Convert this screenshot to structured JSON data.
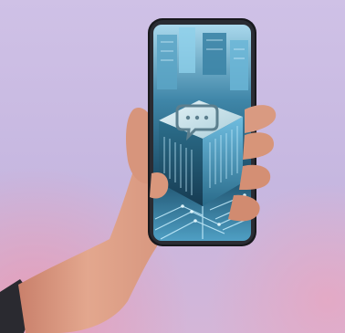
{
  "photo": {
    "subject": "hand-holding-smartphone",
    "background_color": "#c7b9e2",
    "background_glow_color": "#e7a0b8",
    "skin_color": "#dc9f86",
    "phone_frame_color": "#1c1d22",
    "screen_primary_color": "#2b6a86",
    "screen_highlight_color": "#8fd9f2",
    "screen_icon": "chat-bubble-icon"
  }
}
